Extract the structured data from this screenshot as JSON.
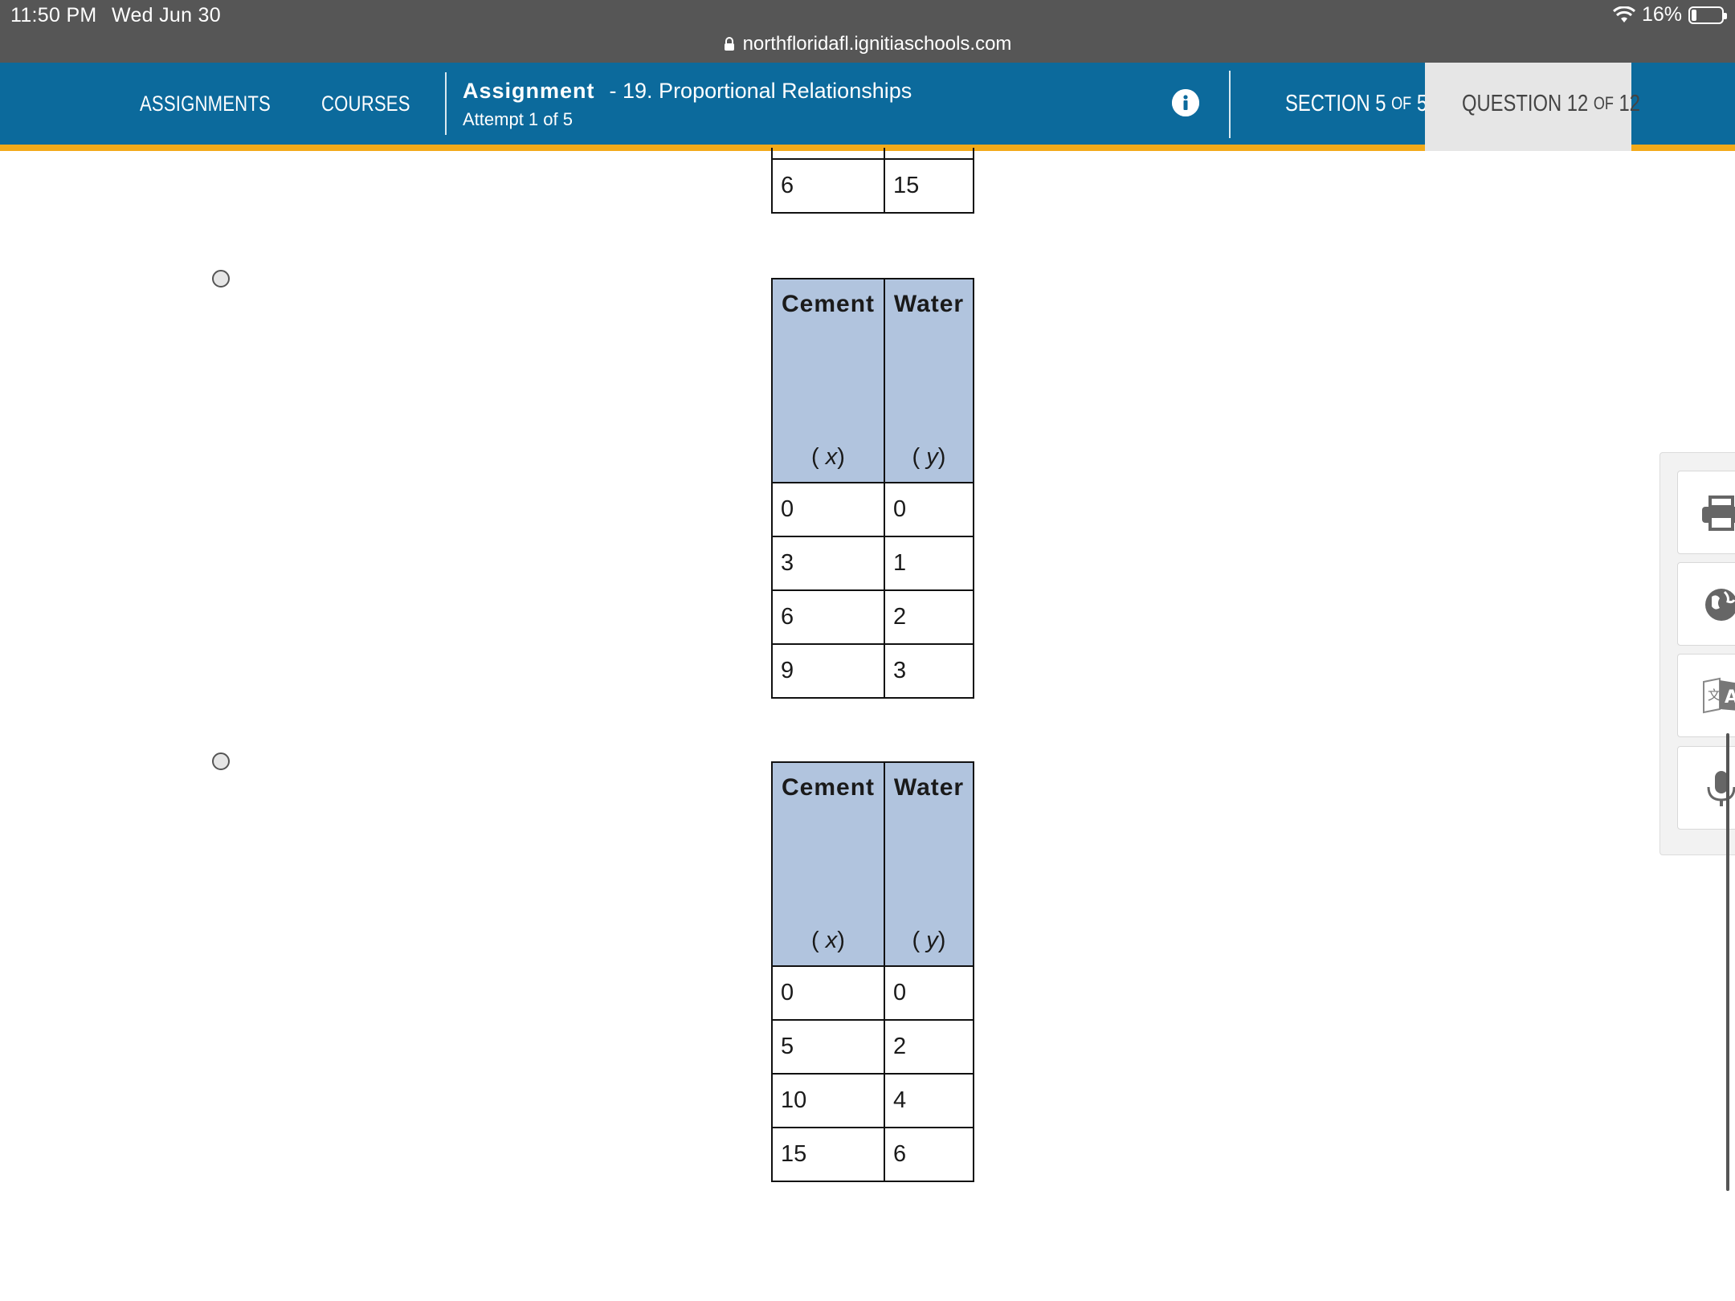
{
  "status_bar": {
    "time": "11:50 PM",
    "date": "Wed Jun 30",
    "battery": "16%",
    "url": "northfloridafl.ignitiaschools.com"
  },
  "nav": {
    "assignments": "ASSIGNMENTS",
    "courses": "COURSES",
    "assignment_label": "Assignment",
    "assignment_name": "- 19. Proportional Relationships",
    "attempt": "Attempt 1 of 5",
    "section_prefix": "SECTION 5",
    "section_of": "OF",
    "section_total": "5",
    "question_prefix": "QUESTION 12",
    "question_of": "OF",
    "question_total": "12"
  },
  "colors": {
    "nav_bg": "#0c6a9c",
    "accent_strip": "#f2aa1a",
    "table_header": "#b1c4de"
  },
  "partial_table": {
    "rows": [
      [
        "6",
        "15"
      ]
    ]
  },
  "options": [
    {
      "header_cement": "Cement",
      "header_water": "Water",
      "var_x": "x",
      "var_y": "y",
      "rows": [
        [
          "0",
          "0"
        ],
        [
          "3",
          "1"
        ],
        [
          "6",
          "2"
        ],
        [
          "9",
          "3"
        ]
      ]
    },
    {
      "header_cement": "Cement",
      "header_water": "Water",
      "var_x": "x",
      "var_y": "y",
      "rows": [
        [
          "0",
          "0"
        ],
        [
          "5",
          "2"
        ],
        [
          "10",
          "4"
        ],
        [
          "15",
          "6"
        ]
      ]
    }
  ],
  "tools": [
    "printer-icon",
    "globe-icon",
    "translate-icon",
    "microphone-icon"
  ]
}
